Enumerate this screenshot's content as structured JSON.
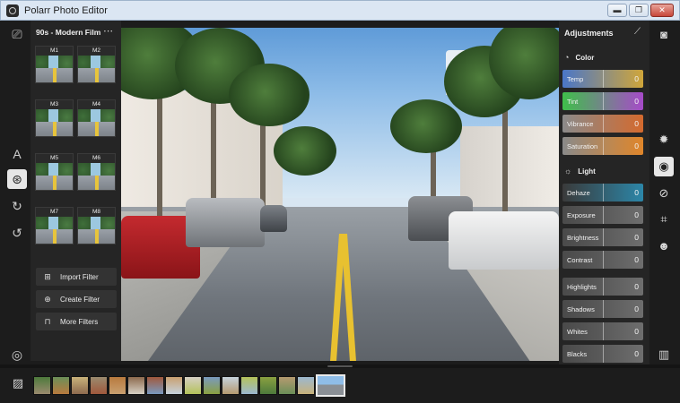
{
  "window": {
    "title": "Polarr Photo Editor",
    "controls": {
      "minimize": "▬",
      "maximize": "❐",
      "close": "✕"
    }
  },
  "left_rail": {
    "icons": [
      "feedback-icon",
      "text-icon",
      "filters-icon",
      "history-icon",
      "undo-icon",
      "settings-icon"
    ],
    "glyphs": {
      "feedback": "⎚",
      "text": "A",
      "filters": "⊛",
      "history": "↻",
      "undo": "↺",
      "settings": "◎"
    }
  },
  "filters_panel": {
    "title": "90s - Modern Film",
    "more": "⋯",
    "thumbnails": [
      "M1",
      "M2",
      "M3",
      "M4",
      "M5",
      "M6",
      "M7",
      "M8"
    ],
    "buttons": [
      {
        "label": "Import Filter",
        "icon": "qr-icon",
        "glyph": "⊞"
      },
      {
        "label": "Create Filter",
        "icon": "create-filter-icon",
        "glyph": "⊕"
      },
      {
        "label": "More Filters",
        "icon": "bag-icon",
        "glyph": "⊓"
      }
    ]
  },
  "adjustments": {
    "title": "Adjustments",
    "wand_glyph": "⟋",
    "color_section": {
      "label": "Color",
      "glyph": "◔",
      "sliders": [
        {
          "label": "Temp",
          "value": "0",
          "color_left": "#4a76c8",
          "color_right": "#d0a63a"
        },
        {
          "label": "Tint",
          "value": "0",
          "color_left": "#3fbf4a",
          "color_right": "#a74bc9"
        },
        {
          "label": "Vibrance",
          "value": "0",
          "color_left": "#8a8a8a",
          "color_right": "#d46a2e"
        },
        {
          "label": "Saturation",
          "value": "0",
          "color_left": "#8a8a8a",
          "color_right": "#e0862a"
        }
      ]
    },
    "light_section": {
      "label": "Light",
      "glyph": "☼",
      "sliders": [
        {
          "label": "Dehaze",
          "value": "0",
          "color_left": "#3a3a3a",
          "color_right": "#2c86a8"
        },
        {
          "label": "Exposure",
          "value": "0"
        },
        {
          "label": "Brightness",
          "value": "0"
        },
        {
          "label": "Contrast",
          "value": "0"
        }
      ],
      "sliders2": [
        {
          "label": "Highlights",
          "value": "0"
        },
        {
          "label": "Shadows",
          "value": "0"
        },
        {
          "label": "Whites",
          "value": "0"
        },
        {
          "label": "Blacks",
          "value": "0"
        }
      ]
    }
  },
  "right_rail": {
    "icons": [
      "camera-icon",
      "gear-icon",
      "adjust-icon",
      "retouch-icon",
      "crop-icon",
      "face-icon",
      "compare-icon"
    ],
    "glyphs": {
      "camera": "◙",
      "gear": "✹",
      "adjust": "◉",
      "retouch": "⊘",
      "crop": "⌗",
      "face": "☻",
      "compare": "▥"
    }
  },
  "filmstrip": {
    "gallery_glyph": "▨",
    "thumb_count": 16
  }
}
